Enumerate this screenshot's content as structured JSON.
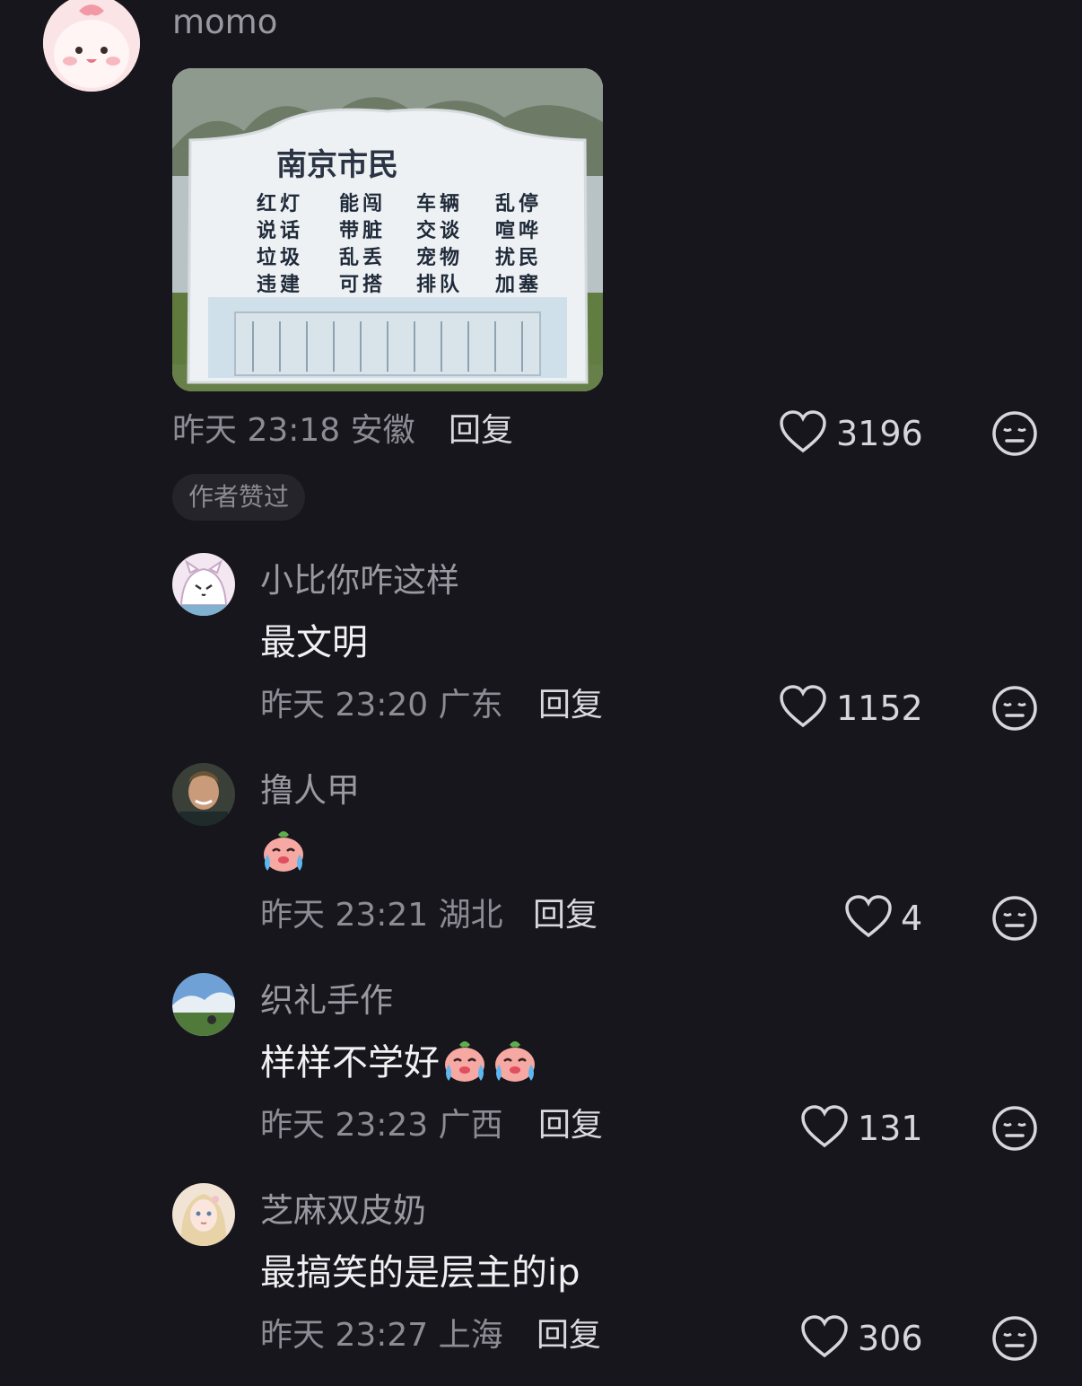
{
  "top_comment": {
    "username": "momo",
    "image": {
      "title": "南京市民",
      "rows": [
        [
          "红灯",
          "能闯",
          "车辆",
          "乱停"
        ],
        [
          "说话",
          "带脏",
          "交谈",
          "喧哗"
        ],
        [
          "垃圾",
          "乱丢",
          "宠物",
          "扰民"
        ],
        [
          "违建",
          "可搭",
          "排队",
          "加塞"
        ]
      ]
    },
    "time": "昨天 23:18",
    "location": "安徽",
    "reply_label": "回复",
    "likes": "3196",
    "badge": "作者赞过"
  },
  "replies": [
    {
      "username": "小比你咋这样",
      "text": "最文明",
      "time": "昨天 23:20",
      "location": "广东",
      "reply_label": "回复",
      "likes": "1152"
    },
    {
      "username": "撸人甲",
      "text": "",
      "time": "昨天 23:21",
      "location": "湖北",
      "reply_label": "回复",
      "likes": "4",
      "emoji_count": 1
    },
    {
      "username": "织礼手作",
      "text": "样样不学好",
      "time": "昨天 23:23",
      "location": "广西",
      "reply_label": "回复",
      "likes": "131",
      "emoji_count": 2
    },
    {
      "username": "芝麻双皮奶",
      "text": "最搞笑的是层主的ip",
      "time": "昨天 23:27",
      "location": "上海",
      "reply_label": "回复",
      "likes": "306"
    }
  ],
  "icons": {
    "like": "heart-outline-icon",
    "dislike": "meh-face-icon",
    "emoji": "crying-peach-emoji"
  },
  "colors": {
    "background": "#17161c",
    "meta_text": "#8d8c95",
    "username_text": "#9a99a2",
    "badge_bg": "#25242b"
  }
}
